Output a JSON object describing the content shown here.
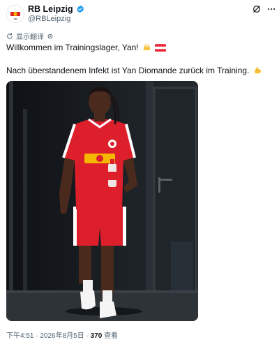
{
  "author": {
    "name": "RB Leipzig",
    "handle": "@RBLeipzig",
    "verified": true,
    "avatar_icon": "rb-leipzig-logo"
  },
  "actions": {
    "grok_icon": "slash-circle-icon",
    "more_icon": "more-icon"
  },
  "translate": {
    "label": "显示翻译"
  },
  "tweet": {
    "line1": "Willkommen im Trainingslager, Yan!",
    "line1_emojis": [
      "raising-hands",
      "austria-flag"
    ],
    "line2": "Nach überstandenem Infekt ist Yan Diomande zurück im Training.",
    "line2_emoji": "flexed-biceps"
  },
  "photo": {
    "description_icon": "player-photo"
  },
  "meta": {
    "time": "下午4:51",
    "separator1": " · ",
    "date": "2026年8月5日",
    "separator2": " · ",
    "views": "370",
    "views_label": " 查看"
  },
  "colors": {
    "text": "#0f1419",
    "muted": "#536471",
    "verified": "#1d9bf0",
    "kit_red": "#dd1e2b"
  }
}
